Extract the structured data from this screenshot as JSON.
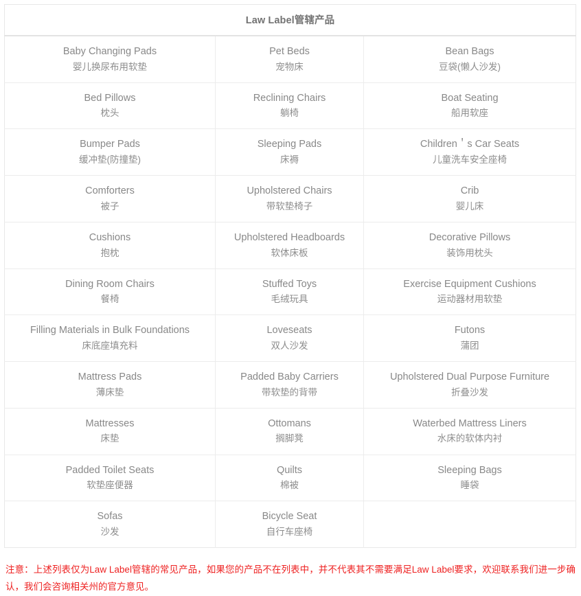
{
  "table": {
    "title": "Law Label管辖产品",
    "columns": 3,
    "rows": [
      [
        {
          "en": "Baby Changing Pads",
          "zh": "婴儿换尿布用软垫"
        },
        {
          "en": "Pet Beds",
          "zh": "宠物床"
        },
        {
          "en": "Bean Bags",
          "zh": "豆袋(懒人沙发)"
        }
      ],
      [
        {
          "en": "Bed Pillows",
          "zh": "枕头"
        },
        {
          "en": "Reclining Chairs",
          "zh": "躺椅"
        },
        {
          "en": "Boat Seating",
          "zh": "船用软座"
        }
      ],
      [
        {
          "en": "Bumper Pads",
          "zh": "缓冲垫(防撞垫)"
        },
        {
          "en": "Sleeping Pads",
          "zh": "床褥"
        },
        {
          "en": "Children＇s Car Seats",
          "zh": "儿童洗车安全座椅"
        }
      ],
      [
        {
          "en": "Comforters",
          "zh": "被子"
        },
        {
          "en": "Upholstered Chairs",
          "zh": "带软垫椅子"
        },
        {
          "en": "Crib",
          "zh": "婴儿床"
        }
      ],
      [
        {
          "en": "Cushions",
          "zh": "抱枕"
        },
        {
          "en": "Upholstered Headboards",
          "zh": "软体床板"
        },
        {
          "en": "Decorative Pillows",
          "zh": "装饰用枕头"
        }
      ],
      [
        {
          "en": "Dining Room Chairs",
          "zh": "餐椅"
        },
        {
          "en": "Stuffed Toys",
          "zh": "毛绒玩具"
        },
        {
          "en": "Exercise Equipment Cushions",
          "zh": "运动器材用软垫"
        }
      ],
      [
        {
          "en": "Filling Materials in Bulk Foundations",
          "zh": "床底座填充料"
        },
        {
          "en": "Loveseats",
          "zh": "双人沙发"
        },
        {
          "en": "Futons",
          "zh": "蒲团"
        }
      ],
      [
        {
          "en": "Mattress Pads",
          "zh": "薄床垫"
        },
        {
          "en": "Padded Baby Carriers",
          "zh": "带软垫的背带"
        },
        {
          "en": "Upholstered Dual Purpose Furniture",
          "zh": "折叠沙发"
        }
      ],
      [
        {
          "en": "Mattresses",
          "zh": "床垫"
        },
        {
          "en": "Ottomans",
          "zh": "搁脚凳"
        },
        {
          "en": "Waterbed Mattress Liners",
          "zh": "水床的软体内衬"
        }
      ],
      [
        {
          "en": "Padded Toilet Seats",
          "zh": "软垫座便器"
        },
        {
          "en": "Quilts",
          "zh": "棉被"
        },
        {
          "en": "Sleeping Bags",
          "zh": "睡袋"
        }
      ],
      [
        {
          "en": "Sofas",
          "zh": "沙发"
        },
        {
          "en": "Bicycle Seat",
          "zh": "自行车座椅"
        },
        {
          "en": "",
          "zh": ""
        }
      ]
    ]
  },
  "footnote": {
    "text": "注意：上述列表仅为Law Label管辖的常见产品，如果您的产品不在列表中，并不代表其不需要满足Law Label要求，欢迎联系我们进一步确认，我们会咨询相关州的官方意见。",
    "color": "#ee2222"
  }
}
